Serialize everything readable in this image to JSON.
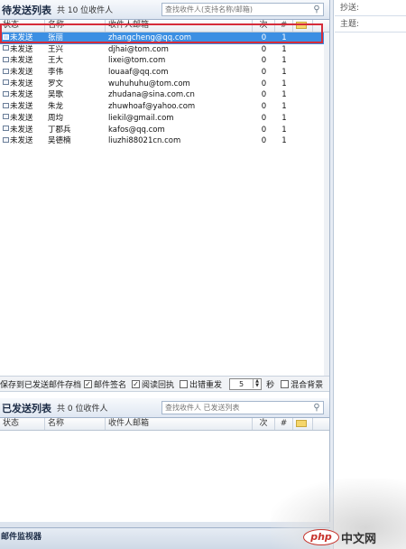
{
  "pending": {
    "title": "待发送列表",
    "count_text": "共 10 位收件人",
    "search_placeholder": "查找收件人(支持名称/邮箱)",
    "columns": {
      "status": "状态",
      "name": "名称",
      "email": "收件人邮箱",
      "n1": "次",
      "n2": "#"
    },
    "rows": [
      {
        "status": "未发送",
        "name": "张丽",
        "email": "zhangcheng@qq.com",
        "n1": "0",
        "n2": "1",
        "selected": true
      },
      {
        "status": "未发送",
        "name": "王兴",
        "email": "djhai@tom.com",
        "n1": "0",
        "n2": "1"
      },
      {
        "status": "未发送",
        "name": "王大",
        "email": "lixei@tom.com",
        "n1": "0",
        "n2": "1"
      },
      {
        "status": "未发送",
        "name": "李伟",
        "email": "louaaf@qq.com",
        "n1": "0",
        "n2": "1"
      },
      {
        "status": "未发送",
        "name": "罗文",
        "email": "wuhuhuhu@tom.com",
        "n1": "0",
        "n2": "1"
      },
      {
        "status": "未发送",
        "name": "吴歌",
        "email": "zhudana@sina.com.cn",
        "n1": "0",
        "n2": "1"
      },
      {
        "status": "未发送",
        "name": "朱龙",
        "email": "zhuwhoaf@yahoo.com",
        "n1": "0",
        "n2": "1"
      },
      {
        "status": "未发送",
        "name": "周均",
        "email": "liekil@gmail.com",
        "n1": "0",
        "n2": "1"
      },
      {
        "status": "未发送",
        "name": "丁郡兵",
        "email": "kafos@qq.com",
        "n1": "0",
        "n2": "1"
      },
      {
        "status": "未发送",
        "name": "吴德楠",
        "email": "liuzhi88021cn.com",
        "n1": "0",
        "n2": "1"
      }
    ]
  },
  "options": {
    "save_label": "保存到已发送邮件存档",
    "signature_label": "邮件签名",
    "receipt_label": "阅读回执",
    "retry_label": "出错重发",
    "retry_value": "5",
    "seconds_label": "秒",
    "bg_label": "混合背景",
    "signature_checked": "✓",
    "receipt_checked": "✓"
  },
  "sent": {
    "title": "已发送列表",
    "count_text": "共 0 位收件人",
    "search_placeholder": "查找收件人 已发送列表",
    "columns": {
      "status": "状态",
      "name": "名称",
      "email": "收件人邮箱",
      "n1": "次",
      "n2": "#"
    }
  },
  "right_panel": {
    "cc_label": "抄送:",
    "subject_label": "主题:"
  },
  "monitor": {
    "label": "邮件监视器"
  },
  "watermark": {
    "logo": "php",
    "text": "中文网"
  }
}
